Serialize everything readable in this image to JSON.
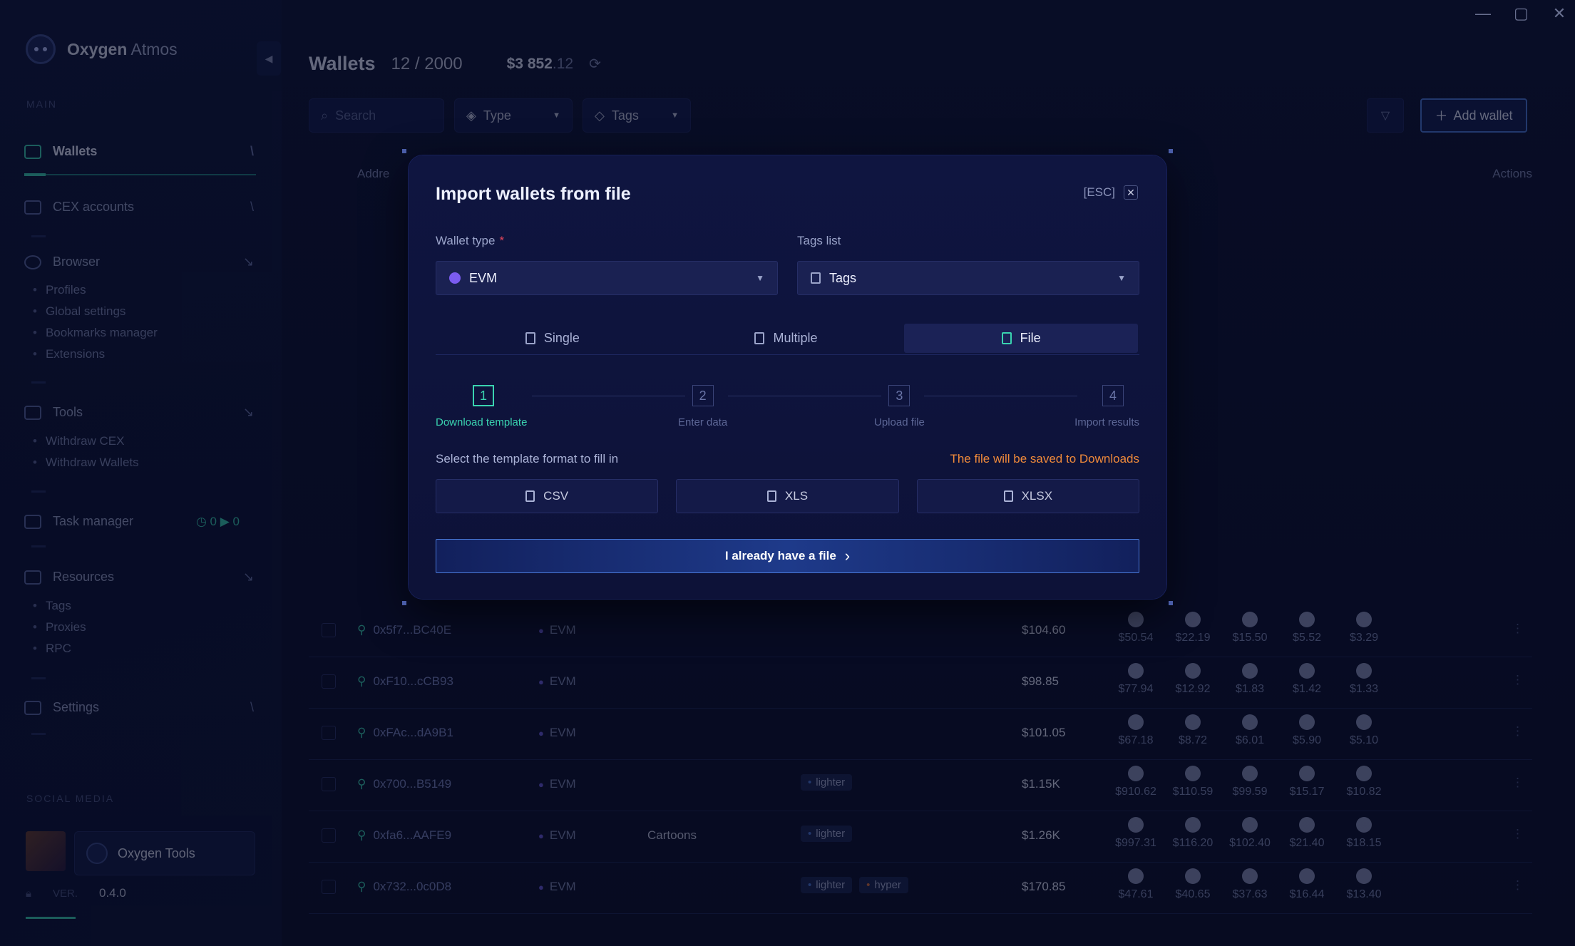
{
  "window_controls": {
    "minimize": "—",
    "maximize": "▢",
    "close": "✕"
  },
  "sidebar": {
    "brand_bold": "Oxygen",
    "brand_rest": " Atmos",
    "section_main": "MAIN",
    "items": [
      {
        "label": "Wallets",
        "arrow": "\\"
      },
      {
        "label": "CEX accounts",
        "arrow": "\\"
      },
      {
        "label": "Browser",
        "arrow": "↘"
      },
      {
        "label": "Tools",
        "arrow": "↘"
      },
      {
        "label": "Task manager"
      },
      {
        "label": "Resources",
        "arrow": "↘"
      },
      {
        "label": "Settings",
        "arrow": "\\"
      }
    ],
    "browser_sub": [
      "Profiles",
      "Global settings",
      "Bookmarks manager",
      "Extensions"
    ],
    "tools_sub": [
      "Withdraw CEX",
      "Withdraw Wallets"
    ],
    "resources_sub": [
      "Tags",
      "Proxies",
      "RPC"
    ],
    "task_counts": "◷ 0   ▶ 0",
    "section_social": "SOCIAL MEDIA",
    "social_card": "Oxygen Tools",
    "version_label": "VER.",
    "version": "0.4.0"
  },
  "main": {
    "title": "Wallets",
    "count": "12 / 2000",
    "balance_main": "$3 852",
    "balance_cents": ".12",
    "search_placeholder": "Search",
    "type_filter": "Type",
    "tags_filter": "Tags",
    "add_wallet": "Add wallet",
    "col_address": "Addre",
    "col_actions": "Actions",
    "rows": [
      {
        "address": "0x5f7...BC40E",
        "type": "EVM",
        "name": "",
        "tags": [],
        "total": "$104.60",
        "assets": [
          "$50.54",
          "$22.19",
          "$15.50",
          "$5.52",
          "$3.29"
        ]
      },
      {
        "address": "0xF10...cCB93",
        "type": "EVM",
        "name": "",
        "tags": [],
        "total": "$98.85",
        "assets": [
          "$77.94",
          "$12.92",
          "$1.83",
          "$1.42",
          "$1.33"
        ]
      },
      {
        "address": "0xFAc...dA9B1",
        "type": "EVM",
        "name": "",
        "tags": [],
        "total": "$101.05",
        "assets": [
          "$67.18",
          "$8.72",
          "$6.01",
          "$5.90",
          "$5.10"
        ]
      },
      {
        "address": "0x700...B5149",
        "type": "EVM",
        "name": "",
        "tags": [
          "lighter"
        ],
        "total": "$1.15K",
        "assets": [
          "$910.62",
          "$110.59",
          "$99.59",
          "$15.17",
          "$10.82"
        ]
      },
      {
        "address": "0xfa6...AAFE9",
        "type": "EVM",
        "name": "Cartoons",
        "tags": [
          "lighter"
        ],
        "total": "$1.26K",
        "assets": [
          "$997.31",
          "$116.20",
          "$102.40",
          "$21.40",
          "$18.15"
        ]
      },
      {
        "address": "0x732...0c0D8",
        "type": "EVM",
        "name": "",
        "tags": [
          "lighter",
          "hyper"
        ],
        "total": "$170.85",
        "assets": [
          "$47.61",
          "$40.65",
          "$37.63",
          "$16.44",
          "$13.40"
        ]
      }
    ]
  },
  "modal": {
    "title": "Import wallets from file",
    "esc": "[ESC]",
    "close": "✕",
    "wallet_type_label": "Wallet type",
    "required_mark": "*",
    "wallet_type_value": "EVM",
    "tags_list_label": "Tags list",
    "tags_value": "Tags",
    "tabs": [
      "Single",
      "Multiple",
      "File"
    ],
    "steps": [
      {
        "num": "1",
        "label": "Download template"
      },
      {
        "num": "2",
        "label": "Enter data"
      },
      {
        "num": "3",
        "label": "Upload file"
      },
      {
        "num": "4",
        "label": "Import results"
      }
    ],
    "format_label": "Select the template format to fill in",
    "format_note": "The file will be saved to Downloads",
    "formats": [
      "CSV",
      "XLS",
      "XLSX"
    ],
    "primary": "I already have a file",
    "primary_icon": "›"
  }
}
